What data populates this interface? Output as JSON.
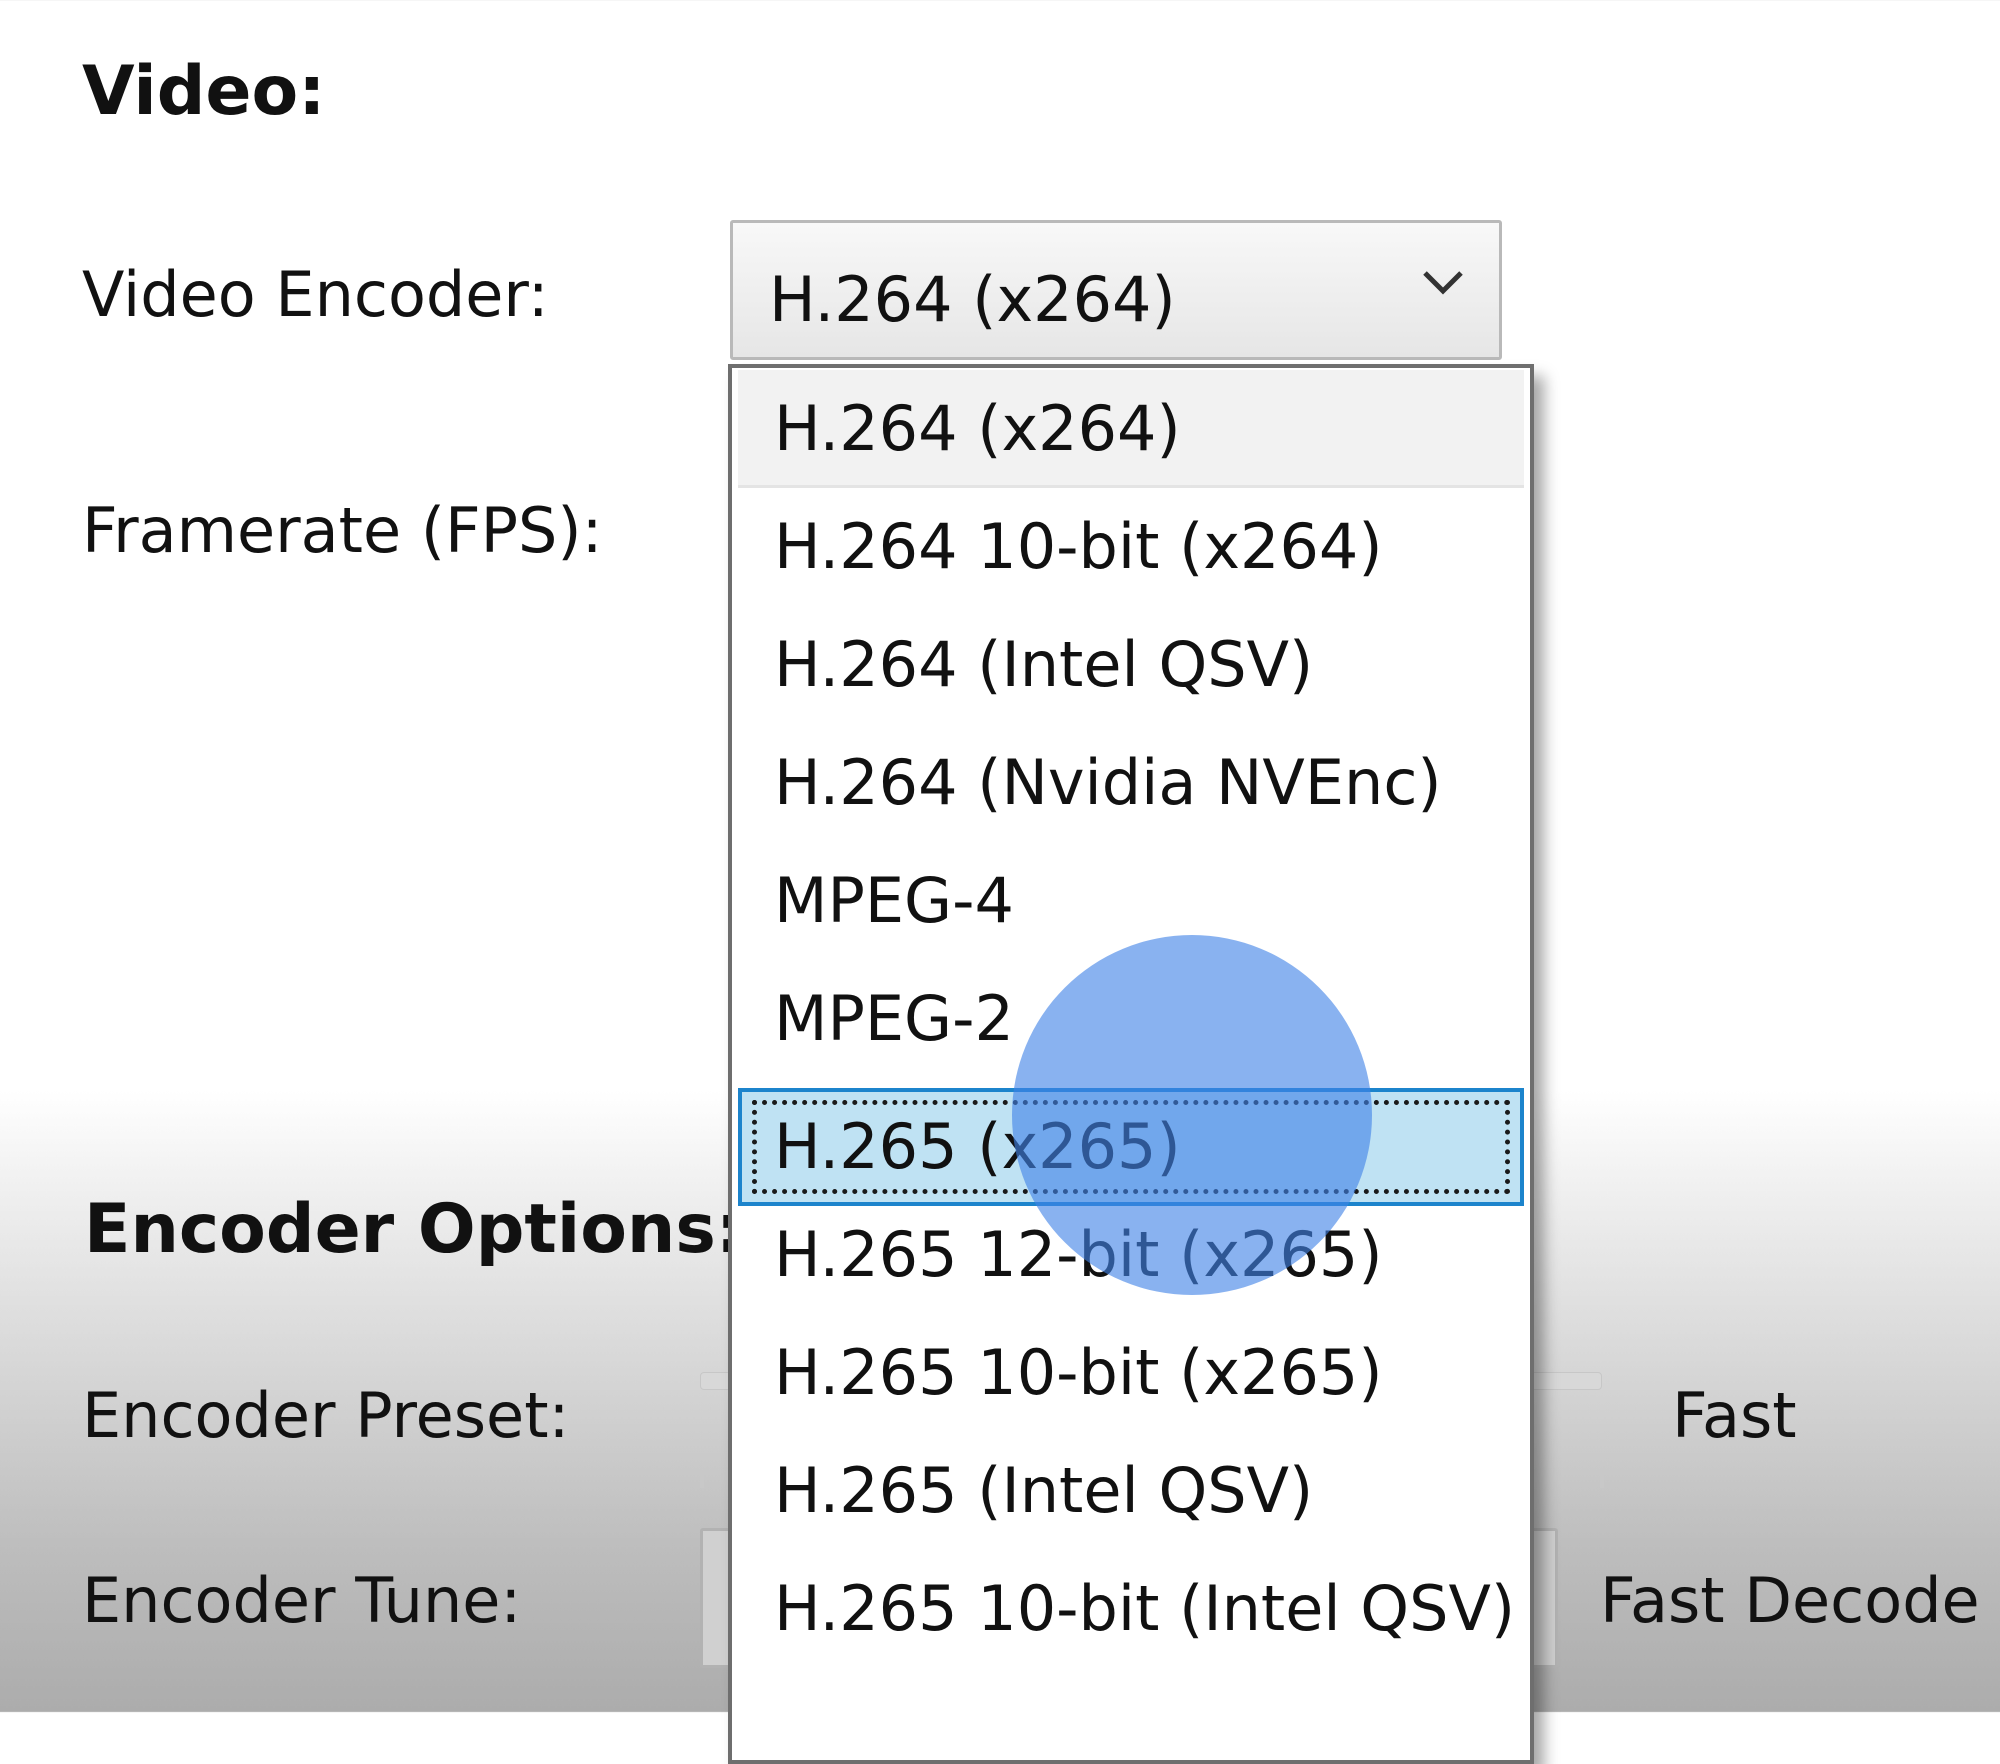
{
  "video": {
    "heading": "Video:",
    "encoder_label": "Video Encoder:",
    "encoder_value": "H.264 (x264)",
    "framerate_label": "Framerate (FPS):"
  },
  "encoder_options": {
    "heading": "Encoder Options:",
    "preset_label": "Encoder Preset:",
    "preset_value": "Fast",
    "tune_label": "Encoder Tune:",
    "tune_value": "Fast Decode"
  },
  "dropdown": {
    "items": [
      {
        "label": "H.264 (x264)",
        "state": "current"
      },
      {
        "label": "H.264 10-bit (x264)",
        "state": "normal"
      },
      {
        "label": "H.264 (Intel QSV)",
        "state": "normal"
      },
      {
        "label": "H.264 (Nvidia NVEnc)",
        "state": "normal"
      },
      {
        "label": "MPEG-4",
        "state": "normal"
      },
      {
        "label": "MPEG-2",
        "state": "normal"
      },
      {
        "label": "H.265 (x265)",
        "state": "highlighted"
      },
      {
        "label": "H.265 12-bit (x265)",
        "state": "normal"
      },
      {
        "label": "H.265 10-bit (x265)",
        "state": "normal"
      },
      {
        "label": "H.265 (Intel QSV)",
        "state": "normal"
      },
      {
        "label": "H.265 10-bit (Intel QSV)",
        "state": "normal"
      }
    ]
  },
  "colors": {
    "highlight_fill": "#bfe2f3",
    "highlight_border": "#1c84cc",
    "touch_indicator": "#4182e6"
  },
  "icons": {
    "combo_arrow": "chevron-down-icon"
  }
}
